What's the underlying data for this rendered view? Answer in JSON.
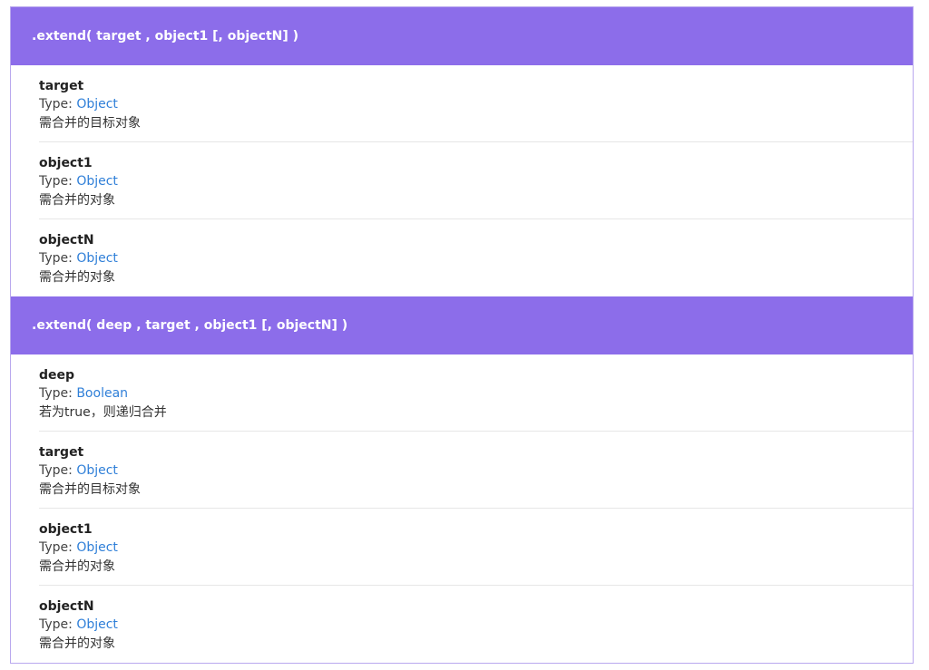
{
  "sections": [
    {
      "signature": ".extend( target , object1 [, objectN] )",
      "params": [
        {
          "name": "target",
          "type_label": "Type: ",
          "type": "Object",
          "desc": "需合并的目标对象"
        },
        {
          "name": "object1",
          "type_label": "Type: ",
          "type": "Object",
          "desc": "需合并的对象"
        },
        {
          "name": "objectN",
          "type_label": "Type: ",
          "type": "Object",
          "desc": "需合并的对象"
        }
      ]
    },
    {
      "signature": ".extend( deep , target , object1 [, objectN] )",
      "params": [
        {
          "name": "deep",
          "type_label": "Type: ",
          "type": "Boolean",
          "desc": "若为true，则递归合并"
        },
        {
          "name": "target",
          "type_label": "Type: ",
          "type": "Object",
          "desc": "需合并的目标对象"
        },
        {
          "name": "object1",
          "type_label": "Type: ",
          "type": "Object",
          "desc": "需合并的对象"
        },
        {
          "name": "objectN",
          "type_label": "Type: ",
          "type": "Object",
          "desc": "需合并的对象"
        }
      ]
    }
  ],
  "colors": {
    "header_bg": "#8c6dea",
    "link": "#2f7fd8"
  }
}
